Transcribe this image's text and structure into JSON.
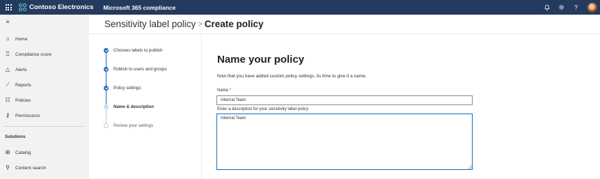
{
  "topbar": {
    "brand": "Contoso Electronics",
    "app_name": "Microsoft 365 compliance",
    "icons": [
      "waffle-icon",
      "bell-icon",
      "gear-icon",
      "help-icon",
      "avatar"
    ]
  },
  "leftnav": {
    "items": [
      {
        "label": "Home",
        "icon": "home-icon"
      },
      {
        "label": "Compliance score",
        "icon": "trophy-icon"
      },
      {
        "label": "Alerts",
        "icon": "alert-icon"
      },
      {
        "label": "Reports",
        "icon": "chart-icon"
      },
      {
        "label": "Policies",
        "icon": "sliders-icon"
      },
      {
        "label": "Permissions",
        "icon": "key-icon"
      }
    ],
    "section_title": "Solutions",
    "solutions": [
      {
        "label": "Catalog",
        "icon": "catalog-icon"
      },
      {
        "label": "Content search",
        "icon": "search-icon"
      }
    ]
  },
  "header": {
    "crumb": "Sensitivity label policy",
    "separator": ">",
    "current": "Create policy"
  },
  "steps": [
    {
      "label": "Chooses labels to publish",
      "state": "done"
    },
    {
      "label": "Publish to users and groups",
      "state": "done"
    },
    {
      "label": "Policy settings",
      "state": "done"
    },
    {
      "label": "Name & description",
      "state": "current"
    },
    {
      "label": "Review your settings",
      "state": "todo"
    }
  ],
  "form": {
    "title": "Name your policy",
    "description": "Now that you have added custom policy settings, its time to give it a name.",
    "name_label": "Name",
    "required_mark": "*",
    "name_value": "Internal Team",
    "desc_label": "Enter a description for your sensitivity label policy",
    "desc_value": "Internal Team"
  },
  "colors": {
    "topbar": "#243a5e",
    "accent": "#0f6cbd",
    "nav_bg": "#f3f2f1"
  }
}
